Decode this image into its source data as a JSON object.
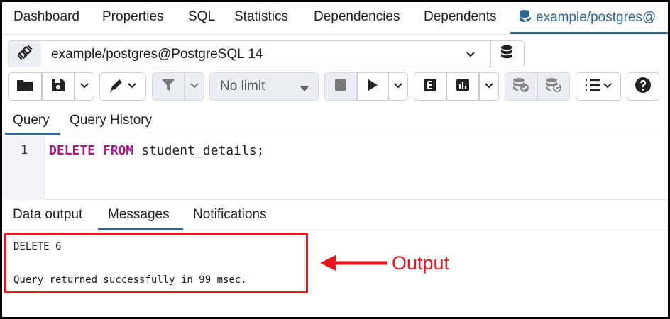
{
  "top_tabs": [
    "Dashboard",
    "Properties",
    "SQL",
    "Statistics",
    "Dependencies",
    "Dependents"
  ],
  "active_connection_tab": "example/postgres@",
  "connection": {
    "selected": "example/postgres@PostgreSQL 14"
  },
  "toolbar": {
    "limit_select": "No limit"
  },
  "query_tabs": [
    "Query",
    "Query History"
  ],
  "editor": {
    "line_number": "1",
    "kw_delete": "DELETE",
    "kw_from": "FROM",
    "rest": " student_details;"
  },
  "output_tabs": [
    "Data output",
    "Messages",
    "Notifications"
  ],
  "messages": {
    "line1": "DELETE 6",
    "line2": "Query returned successfully in 99 msec."
  },
  "annotation": {
    "label": "Output",
    "color": "#e8161f"
  },
  "colors": {
    "accent": "#326690",
    "keyword": "#a31c88"
  }
}
